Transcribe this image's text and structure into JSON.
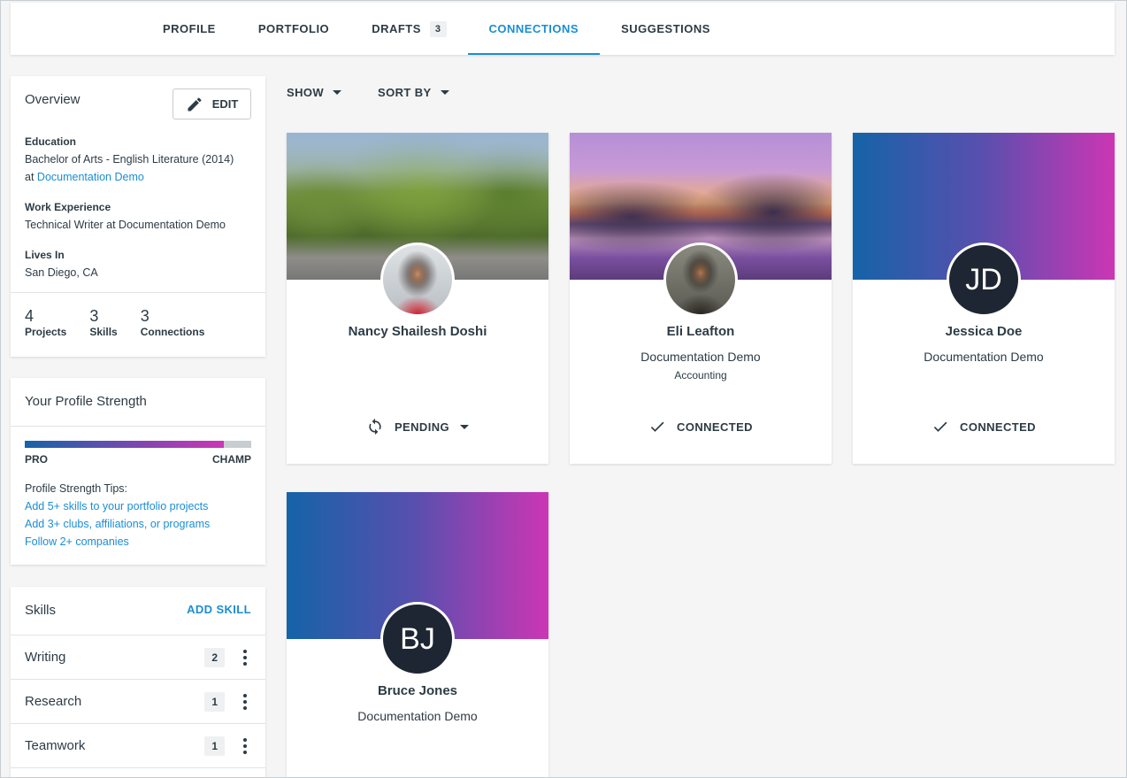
{
  "nav": {
    "tabs": [
      {
        "label": "PROFILE"
      },
      {
        "label": "PORTFOLIO"
      },
      {
        "label": "DRAFTS",
        "badge": "3"
      },
      {
        "label": "CONNECTIONS"
      },
      {
        "label": "SUGGESTIONS"
      }
    ],
    "active_tab": "CONNECTIONS"
  },
  "overview": {
    "title": "Overview",
    "edit_label": "EDIT",
    "education_label": "Education",
    "education_value": "Bachelor of Arts - English Literature (2014)",
    "education_at": "at",
    "education_link": "Documentation Demo",
    "work_label": "Work Experience",
    "work_value": "Technical Writer at Documentation Demo",
    "lives_label": "Lives In",
    "lives_value": "San Diego, CA",
    "stats": [
      {
        "num": "4",
        "label": "Projects"
      },
      {
        "num": "3",
        "label": "Skills"
      },
      {
        "num": "3",
        "label": "Connections"
      }
    ]
  },
  "strength": {
    "title": "Your Profile Strength",
    "level_fraction": 0.88,
    "left_label": "PRO",
    "right_label": "CHAMP",
    "tips_title": "Profile Strength Tips:",
    "tips": [
      "Add 5+ skills to your portfolio projects",
      "Add 3+ clubs, affiliations, or programs",
      "Follow 2+ companies"
    ]
  },
  "skills": {
    "title": "Skills",
    "add_label": "ADD SKILL",
    "items": [
      {
        "name": "Writing",
        "count": "2"
      },
      {
        "name": "Research",
        "count": "1"
      },
      {
        "name": "Teamwork",
        "count": "1"
      }
    ]
  },
  "filters": {
    "show_label": "SHOW",
    "sort_label": "SORT BY"
  },
  "connections": [
    {
      "name": "Nancy Shailesh Doshi",
      "org": "",
      "dept": "",
      "status": "PENDING",
      "initials": ""
    },
    {
      "name": "Eli Leafton",
      "org": "Documentation Demo",
      "dept": "Accounting",
      "status": "CONNECTED",
      "initials": ""
    },
    {
      "name": "Jessica Doe",
      "org": "Documentation Demo",
      "dept": "",
      "status": "CONNECTED",
      "initials": "JD"
    },
    {
      "name": "Bruce Jones",
      "org": "Documentation Demo",
      "dept": "",
      "status": "",
      "initials": "BJ"
    }
  ],
  "colors": {
    "accent": "#1b8dd4",
    "text": "#2d3b45",
    "avatar_bg": "#1e2633"
  }
}
